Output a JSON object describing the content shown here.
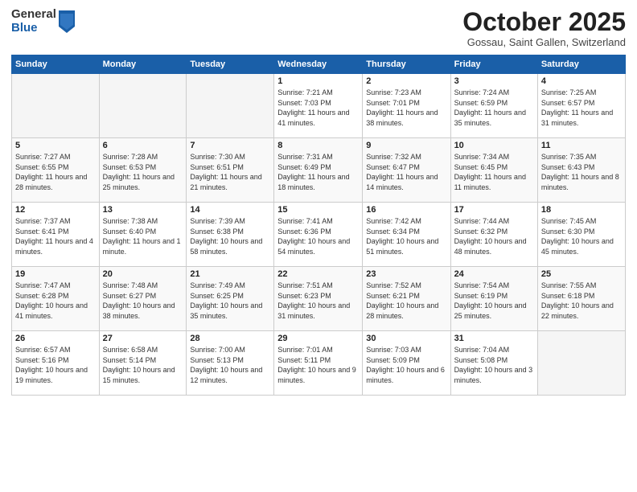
{
  "logo": {
    "general": "General",
    "blue": "Blue"
  },
  "header": {
    "month": "October 2025",
    "location": "Gossau, Saint Gallen, Switzerland"
  },
  "days_of_week": [
    "Sunday",
    "Monday",
    "Tuesday",
    "Wednesday",
    "Thursday",
    "Friday",
    "Saturday"
  ],
  "weeks": [
    [
      {
        "day": "",
        "sunrise": "",
        "sunset": "",
        "daylight": "",
        "empty": true
      },
      {
        "day": "",
        "sunrise": "",
        "sunset": "",
        "daylight": "",
        "empty": true
      },
      {
        "day": "",
        "sunrise": "",
        "sunset": "",
        "daylight": "",
        "empty": true
      },
      {
        "day": "1",
        "sunrise": "Sunrise: 7:21 AM",
        "sunset": "Sunset: 7:03 PM",
        "daylight": "Daylight: 11 hours and 41 minutes."
      },
      {
        "day": "2",
        "sunrise": "Sunrise: 7:23 AM",
        "sunset": "Sunset: 7:01 PM",
        "daylight": "Daylight: 11 hours and 38 minutes."
      },
      {
        "day": "3",
        "sunrise": "Sunrise: 7:24 AM",
        "sunset": "Sunset: 6:59 PM",
        "daylight": "Daylight: 11 hours and 35 minutes."
      },
      {
        "day": "4",
        "sunrise": "Sunrise: 7:25 AM",
        "sunset": "Sunset: 6:57 PM",
        "daylight": "Daylight: 11 hours and 31 minutes."
      }
    ],
    [
      {
        "day": "5",
        "sunrise": "Sunrise: 7:27 AM",
        "sunset": "Sunset: 6:55 PM",
        "daylight": "Daylight: 11 hours and 28 minutes."
      },
      {
        "day": "6",
        "sunrise": "Sunrise: 7:28 AM",
        "sunset": "Sunset: 6:53 PM",
        "daylight": "Daylight: 11 hours and 25 minutes."
      },
      {
        "day": "7",
        "sunrise": "Sunrise: 7:30 AM",
        "sunset": "Sunset: 6:51 PM",
        "daylight": "Daylight: 11 hours and 21 minutes."
      },
      {
        "day": "8",
        "sunrise": "Sunrise: 7:31 AM",
        "sunset": "Sunset: 6:49 PM",
        "daylight": "Daylight: 11 hours and 18 minutes."
      },
      {
        "day": "9",
        "sunrise": "Sunrise: 7:32 AM",
        "sunset": "Sunset: 6:47 PM",
        "daylight": "Daylight: 11 hours and 14 minutes."
      },
      {
        "day": "10",
        "sunrise": "Sunrise: 7:34 AM",
        "sunset": "Sunset: 6:45 PM",
        "daylight": "Daylight: 11 hours and 11 minutes."
      },
      {
        "day": "11",
        "sunrise": "Sunrise: 7:35 AM",
        "sunset": "Sunset: 6:43 PM",
        "daylight": "Daylight: 11 hours and 8 minutes."
      }
    ],
    [
      {
        "day": "12",
        "sunrise": "Sunrise: 7:37 AM",
        "sunset": "Sunset: 6:41 PM",
        "daylight": "Daylight: 11 hours and 4 minutes."
      },
      {
        "day": "13",
        "sunrise": "Sunrise: 7:38 AM",
        "sunset": "Sunset: 6:40 PM",
        "daylight": "Daylight: 11 hours and 1 minute."
      },
      {
        "day": "14",
        "sunrise": "Sunrise: 7:39 AM",
        "sunset": "Sunset: 6:38 PM",
        "daylight": "Daylight: 10 hours and 58 minutes."
      },
      {
        "day": "15",
        "sunrise": "Sunrise: 7:41 AM",
        "sunset": "Sunset: 6:36 PM",
        "daylight": "Daylight: 10 hours and 54 minutes."
      },
      {
        "day": "16",
        "sunrise": "Sunrise: 7:42 AM",
        "sunset": "Sunset: 6:34 PM",
        "daylight": "Daylight: 10 hours and 51 minutes."
      },
      {
        "day": "17",
        "sunrise": "Sunrise: 7:44 AM",
        "sunset": "Sunset: 6:32 PM",
        "daylight": "Daylight: 10 hours and 48 minutes."
      },
      {
        "day": "18",
        "sunrise": "Sunrise: 7:45 AM",
        "sunset": "Sunset: 6:30 PM",
        "daylight": "Daylight: 10 hours and 45 minutes."
      }
    ],
    [
      {
        "day": "19",
        "sunrise": "Sunrise: 7:47 AM",
        "sunset": "Sunset: 6:28 PM",
        "daylight": "Daylight: 10 hours and 41 minutes."
      },
      {
        "day": "20",
        "sunrise": "Sunrise: 7:48 AM",
        "sunset": "Sunset: 6:27 PM",
        "daylight": "Daylight: 10 hours and 38 minutes."
      },
      {
        "day": "21",
        "sunrise": "Sunrise: 7:49 AM",
        "sunset": "Sunset: 6:25 PM",
        "daylight": "Daylight: 10 hours and 35 minutes."
      },
      {
        "day": "22",
        "sunrise": "Sunrise: 7:51 AM",
        "sunset": "Sunset: 6:23 PM",
        "daylight": "Daylight: 10 hours and 31 minutes."
      },
      {
        "day": "23",
        "sunrise": "Sunrise: 7:52 AM",
        "sunset": "Sunset: 6:21 PM",
        "daylight": "Daylight: 10 hours and 28 minutes."
      },
      {
        "day": "24",
        "sunrise": "Sunrise: 7:54 AM",
        "sunset": "Sunset: 6:19 PM",
        "daylight": "Daylight: 10 hours and 25 minutes."
      },
      {
        "day": "25",
        "sunrise": "Sunrise: 7:55 AM",
        "sunset": "Sunset: 6:18 PM",
        "daylight": "Daylight: 10 hours and 22 minutes."
      }
    ],
    [
      {
        "day": "26",
        "sunrise": "Sunrise: 6:57 AM",
        "sunset": "Sunset: 5:16 PM",
        "daylight": "Daylight: 10 hours and 19 minutes."
      },
      {
        "day": "27",
        "sunrise": "Sunrise: 6:58 AM",
        "sunset": "Sunset: 5:14 PM",
        "daylight": "Daylight: 10 hours and 15 minutes."
      },
      {
        "day": "28",
        "sunrise": "Sunrise: 7:00 AM",
        "sunset": "Sunset: 5:13 PM",
        "daylight": "Daylight: 10 hours and 12 minutes."
      },
      {
        "day": "29",
        "sunrise": "Sunrise: 7:01 AM",
        "sunset": "Sunset: 5:11 PM",
        "daylight": "Daylight: 10 hours and 9 minutes."
      },
      {
        "day": "30",
        "sunrise": "Sunrise: 7:03 AM",
        "sunset": "Sunset: 5:09 PM",
        "daylight": "Daylight: 10 hours and 6 minutes."
      },
      {
        "day": "31",
        "sunrise": "Sunrise: 7:04 AM",
        "sunset": "Sunset: 5:08 PM",
        "daylight": "Daylight: 10 hours and 3 minutes."
      },
      {
        "day": "",
        "sunrise": "",
        "sunset": "",
        "daylight": "",
        "empty": true
      }
    ]
  ]
}
